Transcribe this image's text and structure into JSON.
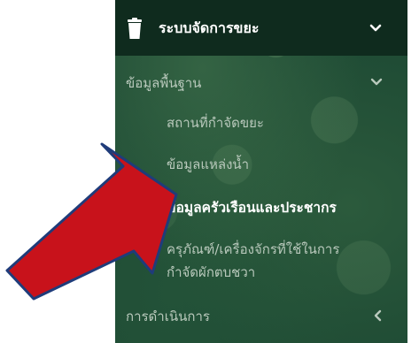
{
  "menu": {
    "section_title": "ระบบจัดการขยะ",
    "section_icon": "trash-icon",
    "groups": [
      {
        "label": "ข้อมูลพื้นฐาน",
        "items": [
          {
            "label": "สถานที่กำจัดขยะ"
          },
          {
            "label": "ข้อมูลแหล่งน้ำ"
          },
          {
            "label": "ข้อมูลครัวเรือนและประชากร"
          },
          {
            "label": "ครุภัณฑ์/เครื่องจักรที่ใช้ในการ"
          },
          {
            "label": "กำจัดผักตบชวา"
          }
        ]
      },
      {
        "label": "การดำเนินการ"
      }
    ]
  },
  "colors": {
    "top_bar": "#0f2b1e",
    "sidebar_bg": "#1e4a34",
    "menu_text": "#b9c9bc",
    "active_text": "#ffffff",
    "arrow_fill": "#c8121b",
    "arrow_stroke": "#1f3c7a"
  }
}
